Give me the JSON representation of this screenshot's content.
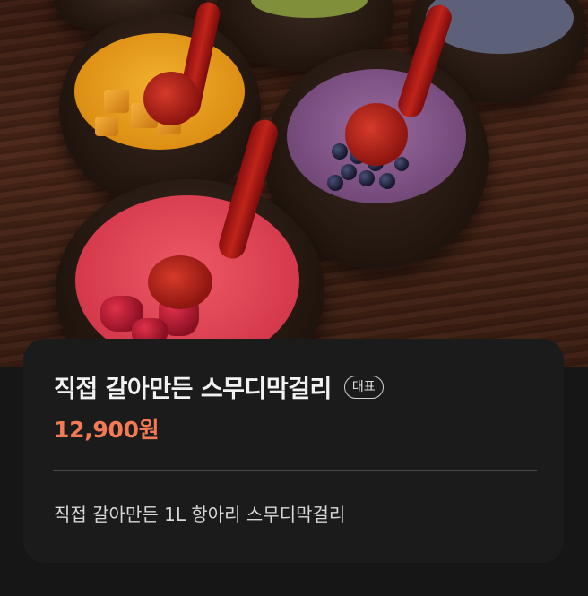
{
  "product": {
    "image_alt": "항아리 스무디막걸리",
    "title": "직접 갈아만든 스무디막걸리",
    "badge": "대표",
    "price": "12,900원",
    "description": "직접 갈아만든 1L 항아리 스무디막걸리"
  },
  "colors": {
    "price": "#f47a56",
    "card_background": "#1b1b1b",
    "page_background": "#161616"
  }
}
